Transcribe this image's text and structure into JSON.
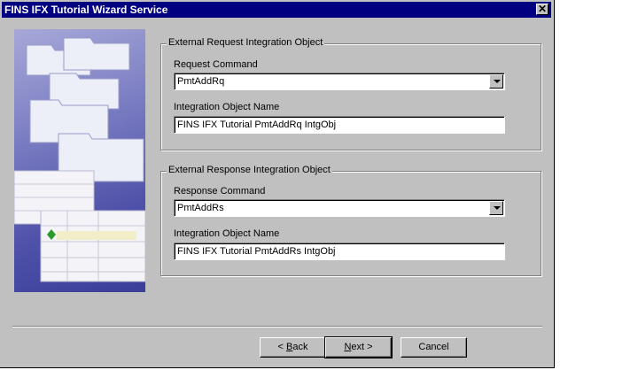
{
  "window": {
    "title": "FINS IFX Tutorial Wizard Service",
    "close_glyph": "✕"
  },
  "request_group": {
    "legend": "External Request Integration Object",
    "command_label": "Request Command",
    "command_value": "PmtAddRq",
    "object_label": "Integration Object Name",
    "object_value": "FINS IFX Tutorial PmtAddRq IntgObj"
  },
  "response_group": {
    "legend": "External Response Integration Object",
    "command_label": "Response Command",
    "command_value": "PmtAddRs",
    "object_label": "Integration Object Name",
    "object_value": "FINS IFX Tutorial PmtAddRs IntgObj"
  },
  "buttons": {
    "back_prefix": "< ",
    "back_key": "B",
    "back_rest": "ack",
    "next_key": "N",
    "next_rest": "ext >",
    "cancel": "Cancel"
  },
  "colors": {
    "titlebar": "#000080",
    "dialog": "#c0c0c0",
    "art": "#4f52a8"
  }
}
